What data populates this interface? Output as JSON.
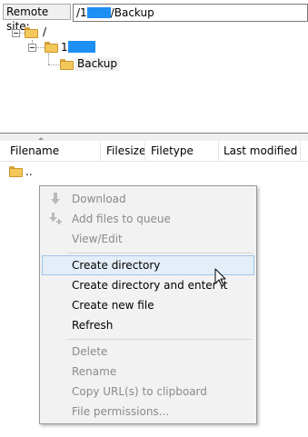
{
  "site": {
    "label": "Remote site:",
    "path_prefix": "/1",
    "path_suffix": "/Backup"
  },
  "tree": {
    "root": "/",
    "child_prefix": "1",
    "grandchild": "Backup"
  },
  "file_list": {
    "columns": [
      "Filename",
      "Filesize",
      "Filetype",
      "Last modified"
    ],
    "rows": [
      {
        "name": ".."
      }
    ]
  },
  "context_menu": {
    "items": [
      {
        "label": "Download",
        "enabled": false,
        "icon": "download-arrow-icon"
      },
      {
        "label": "Add files to queue",
        "enabled": false,
        "icon": "add-to-queue-icon"
      },
      {
        "label": "View/Edit",
        "enabled": false
      },
      {
        "label": "Create directory",
        "enabled": true,
        "highlighted": true
      },
      {
        "label": "Create directory and enter it",
        "enabled": true
      },
      {
        "label": "Create new file",
        "enabled": true
      },
      {
        "label": "Refresh",
        "enabled": true
      },
      {
        "label": "Delete",
        "enabled": false
      },
      {
        "label": "Rename",
        "enabled": false
      },
      {
        "label": "Copy URL(s) to clipboard",
        "enabled": false
      },
      {
        "label": "File permissions...",
        "enabled": false
      }
    ]
  },
  "colors": {
    "highlight_bg": "#e4eef8",
    "highlight_border": "#9ec4eb",
    "redaction_blue": "#1e8ff5",
    "folder_yellow": "#f4c75b"
  }
}
